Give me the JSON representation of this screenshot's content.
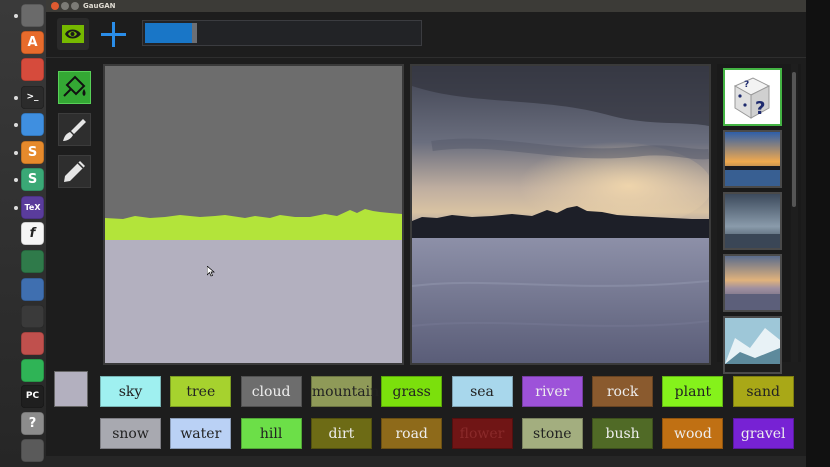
{
  "window": {
    "title": "GauGAN"
  },
  "launcher": {
    "items": [
      {
        "name": "ubuntu-dash-icon",
        "color": "#6a6a6a",
        "glyph": ""
      },
      {
        "name": "software-center-icon",
        "color": "#e76b2c",
        "glyph": "A"
      },
      {
        "name": "settings-icon",
        "color": "#d64b3c",
        "glyph": ""
      },
      {
        "name": "terminal-icon",
        "color": "#2b2b2b",
        "glyph": ">_"
      },
      {
        "name": "chrome-icon",
        "color": "#3f8fe0",
        "glyph": ""
      },
      {
        "name": "sublime-text-icon",
        "color": "#e68a2c",
        "glyph": "S"
      },
      {
        "name": "slack-icon",
        "color": "#3aa876",
        "glyph": "S"
      },
      {
        "name": "texmaker-icon",
        "color": "#5a3c9c",
        "glyph": "TeX"
      },
      {
        "name": "formula-icon",
        "color": "#f5f5f5",
        "glyph": "f"
      },
      {
        "name": "color-picker-icon",
        "color": "#2f7a4a",
        "glyph": ""
      },
      {
        "name": "draw-icon",
        "color": "#3f6fb0",
        "glyph": ""
      },
      {
        "name": "screenshot-icon",
        "color": "#3a3a3a",
        "glyph": ""
      },
      {
        "name": "notes-icon",
        "color": "#c0504d",
        "glyph": ""
      },
      {
        "name": "spotify-icon",
        "color": "#2fb456",
        "glyph": ""
      },
      {
        "name": "pycharm-icon",
        "color": "#1f1f1f",
        "glyph": "PC"
      },
      {
        "name": "help-icon",
        "color": "#8c8c8c",
        "glyph": "?"
      },
      {
        "name": "trash-icon",
        "color": "#5a5a5a",
        "glyph": ""
      }
    ]
  },
  "toolbar": {
    "progress_fraction": 0.17
  },
  "tools": [
    {
      "name": "fill-tool",
      "active": true
    },
    {
      "name": "brush-tool",
      "active": false
    },
    {
      "name": "pencil-tool",
      "active": false
    }
  ],
  "palette": {
    "current_color": "#b3b0bf",
    "swatches": [
      {
        "label": "sky",
        "color": "#9ff0f0",
        "text": "#222"
      },
      {
        "label": "tree",
        "color": "#a6d22e",
        "text": "#222"
      },
      {
        "label": "cloud",
        "color": "#6d6d6d",
        "text": "#eee"
      },
      {
        "label": "mountain",
        "color": "#8f9a58",
        "text": "#222"
      },
      {
        "label": "grass",
        "color": "#7be00c",
        "text": "#222"
      },
      {
        "label": "sea",
        "color": "#a8d7ec",
        "text": "#222"
      },
      {
        "label": "river",
        "color": "#9d52d9",
        "text": "#eee"
      },
      {
        "label": "rock",
        "color": "#8a5a2e",
        "text": "#eee"
      },
      {
        "label": "plant",
        "color": "#85f21b",
        "text": "#222"
      },
      {
        "label": "sand",
        "color": "#a9a817",
        "text": "#222"
      },
      {
        "label": "snow",
        "color": "#a8a9b0",
        "text": "#222"
      },
      {
        "label": "water",
        "color": "#bad1f5",
        "text": "#222"
      },
      {
        "label": "hill",
        "color": "#6cdf48",
        "text": "#222"
      },
      {
        "label": "dirt",
        "color": "#6d6b15",
        "text": "#eee"
      },
      {
        "label": "road",
        "color": "#8e6a1a",
        "text": "#eee"
      },
      {
        "label": "flower",
        "color": "#701515",
        "text": "#8a2a2a"
      },
      {
        "label": "stone",
        "color": "#a3ae7f",
        "text": "#222"
      },
      {
        "label": "bush",
        "color": "#506a26",
        "text": "#eee"
      },
      {
        "label": "wood",
        "color": "#c07013",
        "text": "#eee"
      },
      {
        "label": "gravel",
        "color": "#7722d4",
        "text": "#eee"
      }
    ]
  },
  "colors": {
    "accent_green": "#34a834",
    "accent_blue": "#1976c7"
  }
}
